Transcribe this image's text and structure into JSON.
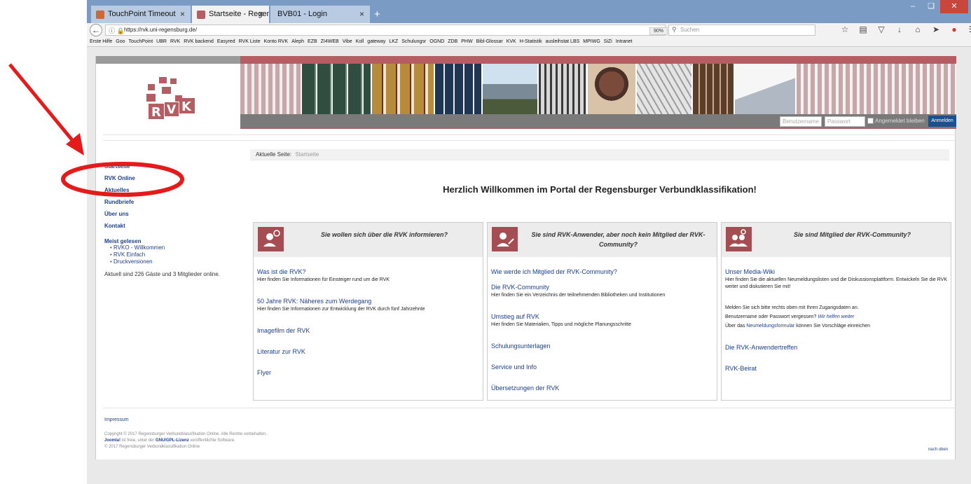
{
  "browser": {
    "tabs": [
      {
        "title": "TouchPoint Timeout",
        "close": "×",
        "active": false
      },
      {
        "title": "Startseite - Regensburger Ver",
        "close": "×",
        "active": true
      },
      {
        "title": "BVB01 - Login",
        "close": "×",
        "active": false
      }
    ],
    "new_tab": "+",
    "url": "https://rvk.uni-regensburg.de/",
    "zoom": "90%",
    "search_placeholder": "Suchen",
    "bookmarks": [
      "Erste Hilfe",
      "Goo",
      "TouchPoint",
      "UBR",
      "RVK",
      "RVK backend",
      "Easyred",
      "RVK Liste",
      "Konto RVK",
      "Aleph",
      "EZB",
      "ZI4WEB",
      "Vibe",
      "Koll",
      "gateway",
      "LKZ",
      "Schulungsr",
      "OGND",
      "ZDB",
      "PHW",
      "Bibl-Glossar",
      "KVK",
      "H-Statistik",
      "ausleihstat LBS",
      "MPIWG",
      "SiZi",
      "Intranet"
    ]
  },
  "header": {
    "login": {
      "username_placeholder": "Benutzername",
      "password_placeholder": "Passwort",
      "remember_label": "Angemeldet bleiben",
      "login_button": "Anmelden"
    }
  },
  "breadcrumb": {
    "label": "Aktuelle Seite:",
    "current": "Startseite"
  },
  "leftnav": {
    "items": [
      "Startseite",
      "RVK Online",
      "Aktuelles",
      "Rundbriefe",
      "Über uns",
      "Kontakt"
    ],
    "mostread_title": "Meist gelesen",
    "mostread": [
      "RVKO - Willkommen",
      "RVK Einfach",
      "Druckversionen"
    ],
    "online_text": "Aktuell sind 226 Gäste und 3 Mitglieder online."
  },
  "welcome": "Herzlich Willkommen im Portal der Regensburger Verbundklassifikation!",
  "panels": [
    {
      "title": "Sie wollen sich über die RVK informieren?",
      "entries": [
        {
          "link": "Was ist die RVK?",
          "desc": "Hier finden Sie Informationen für Einsteiger rund um die RVK"
        },
        {
          "link": "50 Jahre RVK: Näheres zum Werdegang",
          "desc": "Hier finden Sie Informationen zur Entwicklung der RVK durch fünf Jahrzehnte"
        },
        {
          "link": "Imagefilm der RVK",
          "desc": ""
        },
        {
          "link": "Literatur zur RVK",
          "desc": ""
        },
        {
          "link": "Flyer",
          "desc": ""
        }
      ]
    },
    {
      "title": "Sie sind RVK-Anwender, aber noch kein Mitglied der RVK-Community?",
      "entries": [
        {
          "link": "Wie werde ich Mitglied der RVK-Community?",
          "desc": ""
        },
        {
          "link": "Die RVK-Community",
          "desc": "Hier finden Sie ein Verzeichnis der teilnehmenden Bibliotheken und Institutionen"
        },
        {
          "link": "Umstieg auf RVK",
          "desc": "Hier finden Sie Materialien, Tipps und mögliche Planungsschritte"
        },
        {
          "link": "Schulungsunterlagen",
          "desc": ""
        },
        {
          "link": "Service und Info",
          "desc": ""
        },
        {
          "link": "Übersetzungen der RVK",
          "desc": ""
        }
      ]
    },
    {
      "title": "Sie sind Mitglied der RVK-Community?",
      "media_wiki": "Unser Media-Wiki",
      "media_desc": "Hier finden Sie die aktuellen Neumeldungslisten und die Diskussionsplattform. Entwickeln Sie die RVK weiter und diskutieren Sie mit!",
      "login_hint": "Melden Sie sich bitte rechts oben mit Ihren Zugangsdaten an.",
      "forgot_text": "Benutzername oder Passwort vergessen?",
      "forgot_link": "Wir helfen weiter",
      "form_pre": "Über das",
      "form_link": "Neumeldungsformular",
      "form_post": "können Sie Vorschläge einreichen",
      "meet": "Die RVK-Anwendertreffen",
      "board": "RVK-Beirat"
    }
  ],
  "footer": {
    "impressum": "Impressum",
    "copyright1": "Copyright © 2017 Regensburger Verbundklassifikation Online. Alle Rechte vorbehalten.",
    "joomla": "Joomla!",
    "copyright2_mid": "ist freie, unter der",
    "license": "GNU/GPL-Lizenz",
    "copyright2_end": "veröffentlichte Software.",
    "copyright3": "© 2017 Regensburger Verbundklassifikation Online",
    "to_top": "nach oben"
  },
  "colors": {
    "accent": "#b55d62",
    "link": "#1d3f8f",
    "annotation": "#e51b1b"
  }
}
